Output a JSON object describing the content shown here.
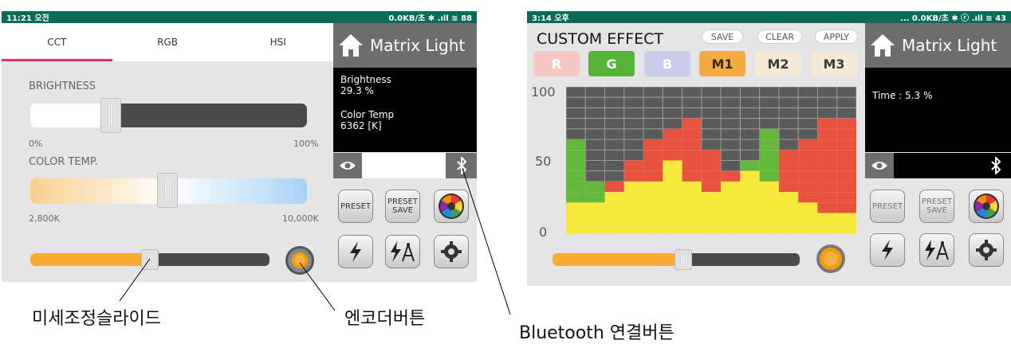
{
  "left": {
    "status_time": "11:21 오전",
    "status_right": "0.0KB/초 ✱ .ıll ≋ 88",
    "tabs": [
      "CCT",
      "RGB",
      "HSI"
    ],
    "brand": "Matrix Light",
    "brightness_label": "BRIGHTNESS",
    "brightness_min": "0%",
    "brightness_max": "100%",
    "brightness_level": 0.293,
    "colortemp_label": "COLOR TEMP.",
    "colortemp_min": "2,800K",
    "colortemp_max": "10,000K",
    "info_brightness_label": "Brightness",
    "info_brightness_value": "29.3 %",
    "info_colortemp_label": "Color Temp",
    "info_colortemp_value": "6362 [K]",
    "preset": "PRESET",
    "preset_save_1": "PRESET",
    "preset_save_2": "SAVE"
  },
  "right": {
    "status_time": "3:14 오후",
    "status_right": "... 0.0KB/초 ✱ ⓡ .ıll ≋ 43",
    "title": "CUSTOM EFFECT",
    "save": "SAVE",
    "clear": "CLEAR",
    "apply": "APPLY",
    "chips": [
      "R",
      "G",
      "B",
      "M1",
      "M2",
      "M3"
    ],
    "y_100": "100",
    "y_50": "50",
    "y_0": "0",
    "brand": "Matrix Light",
    "info_time": "Time : 5.3 %",
    "preset": "PRESET",
    "preset_save_1": "PRESET",
    "preset_save_2": "SAVE"
  },
  "captions": {
    "slider": "미세조정슬라이드",
    "encoder": "엔코더버튼",
    "bluetooth": "Bluetooth  연결버튼"
  },
  "colors": {
    "status": "#0b6b57",
    "tab_active": "#e0306b",
    "slider_orange": "#f9ad2e",
    "grid_red": "#e8533f",
    "grid_yellow": "#f7ea3a",
    "grid_green": "#66b83d",
    "grid_gray": "#5a5a5a"
  }
}
